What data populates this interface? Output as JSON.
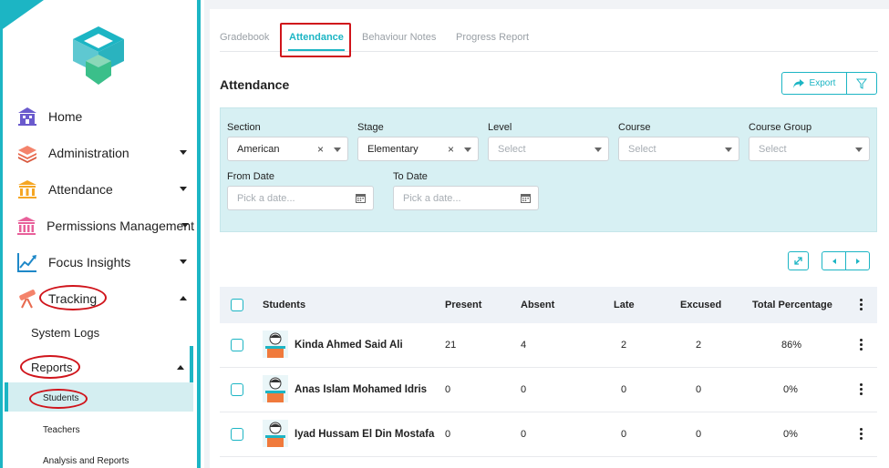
{
  "sidebar": {
    "items": [
      {
        "label": "Home",
        "icon": "home-icon"
      },
      {
        "label": "Administration",
        "icon": "layers-icon"
      },
      {
        "label": "Attendance",
        "icon": "columns-icon"
      },
      {
        "label": "Permissions Management",
        "icon": "bank-icon"
      },
      {
        "label": "Focus Insights",
        "icon": "chart-line-icon"
      },
      {
        "label": "Tracking",
        "icon": "telescope-icon"
      }
    ],
    "tracking_children": {
      "system_logs": "System Logs",
      "reports": "Reports",
      "report_children": [
        "Students",
        "Teachers",
        "Analysis and Reports"
      ]
    }
  },
  "tabs": [
    "Gradebook",
    "Attendance",
    "Behaviour Notes",
    "Progress Report"
  ],
  "page_title": "Attendance",
  "export_label": "Export",
  "filters": {
    "section": {
      "label": "Section",
      "value": "American"
    },
    "stage": {
      "label": "Stage",
      "value": "Elementary"
    },
    "level": {
      "label": "Level",
      "placeholder": "Select"
    },
    "course": {
      "label": "Course",
      "placeholder": "Select"
    },
    "course_group": {
      "label": "Course Group",
      "placeholder": "Select"
    },
    "from_date": {
      "label": "From Date",
      "placeholder": "Pick a date..."
    },
    "to_date": {
      "label": "To Date",
      "placeholder": "Pick a date..."
    }
  },
  "table": {
    "headers": [
      "Students",
      "Present",
      "Absent",
      "Late",
      "Excused",
      "Total Percentage"
    ],
    "rows": [
      {
        "name": "Kinda Ahmed Said Ali",
        "present": "21",
        "absent": "4",
        "late": "2",
        "excused": "2",
        "total": "86%"
      },
      {
        "name": "Anas Islam Mohamed Idris",
        "present": "0",
        "absent": "0",
        "late": "0",
        "excused": "0",
        "total": "0%"
      },
      {
        "name": "Iyad Hussam El Din Mostafa",
        "present": "0",
        "absent": "0",
        "late": "0",
        "excused": "0",
        "total": "0%"
      }
    ]
  },
  "colors": {
    "accent": "#1cb5c4",
    "highlight": "#d0141b",
    "filter_panel": "#d7f0f3"
  }
}
